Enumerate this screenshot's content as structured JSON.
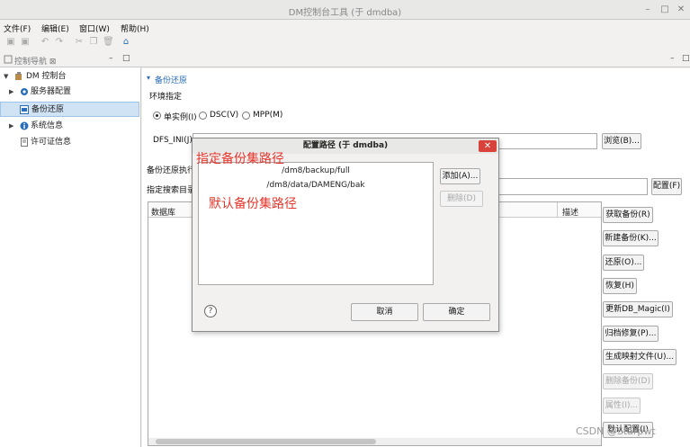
{
  "window": {
    "title": "DM控制台工具 (于 dmdba)"
  },
  "menubar": {
    "items": [
      "文件(F)",
      "编辑(E)",
      "窗口(W)",
      "帮助(H)"
    ]
  },
  "nav": {
    "tab_label": "控制导航 ⊠",
    "items": [
      {
        "label": "DM 控制台",
        "level": 0
      },
      {
        "label": "服务器配置",
        "level": 1
      },
      {
        "label": "备份还原",
        "level": 1,
        "selected": true
      },
      {
        "label": "系统信息",
        "level": 1
      },
      {
        "label": "许可证信息",
        "level": 1
      }
    ]
  },
  "editor": {
    "section_title": "备份还原",
    "env_label": "环境指定",
    "radio_single": "单实例(I)",
    "radio_dsc": "DSC(V)",
    "radio_mpp": "MPP(M)",
    "dfs_label": "DFS_INI(J)",
    "browse_button": "浏览(B)...",
    "backup_exec_label": "备份还原执行",
    "search_dir_label": "指定搜索目录",
    "config_button": "配置(F)",
    "table_headers": [
      "数据库",
      "描述"
    ],
    "side_buttons": [
      {
        "label": "获取备份(R)",
        "enabled": true
      },
      {
        "label": "新建备份(K)...",
        "enabled": true
      },
      {
        "label": "还原(O)...",
        "enabled": true
      },
      {
        "label": "恢复(H)",
        "enabled": true
      },
      {
        "label": "更新DB_Magic(I)",
        "enabled": true
      },
      {
        "label": "归档修复(P)...",
        "enabled": true
      },
      {
        "label": "生成映射文件(U)...",
        "enabled": true
      },
      {
        "label": "删除备份(D)",
        "enabled": false
      },
      {
        "label": "属性(I)...",
        "enabled": false
      },
      {
        "label": "默认配置(I)",
        "enabled": true
      }
    ]
  },
  "dialog": {
    "title": "配置路径 (于 dmdba)",
    "paths": [
      "/dm8/backup/full",
      "/dm8/data/DAMENG/bak"
    ],
    "add_button": "添加(A)...",
    "delete_button": "删除(D)",
    "cancel_button": "取消",
    "ok_button": "确定",
    "help_icon": "?"
  },
  "annotations": {
    "specify_path": "指定备份集路径",
    "default_path": "默认备份集路径"
  },
  "watermark": "CSDN @Starpwt",
  "colors": {
    "annotation_red": "#e5352b",
    "selection_blue": "#cfe3f5",
    "dialog_close_red": "#d9423a"
  }
}
